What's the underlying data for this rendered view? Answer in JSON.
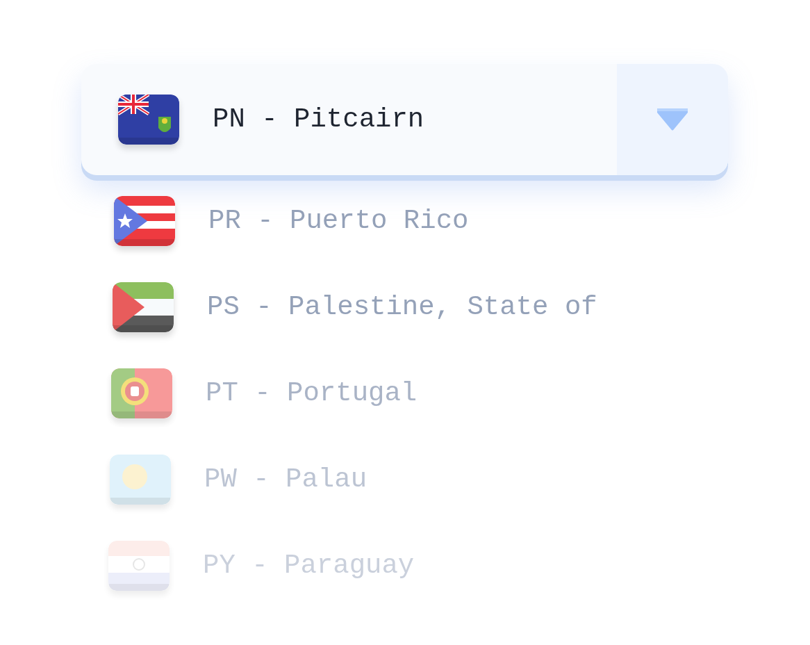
{
  "select": {
    "value": {
      "kind": "pn",
      "label": "PN - Pitcairn"
    },
    "expanded": true
  },
  "options": [
    {
      "kind": "pr",
      "label": "PR - Puerto Rico"
    },
    {
      "kind": "ps",
      "label": "PS - Palestine, State of"
    },
    {
      "kind": "pt",
      "label": "PT - Portugal"
    },
    {
      "kind": "pw",
      "label": "PW - Palau"
    },
    {
      "kind": "py",
      "label": "PY - Paraguay"
    }
  ]
}
